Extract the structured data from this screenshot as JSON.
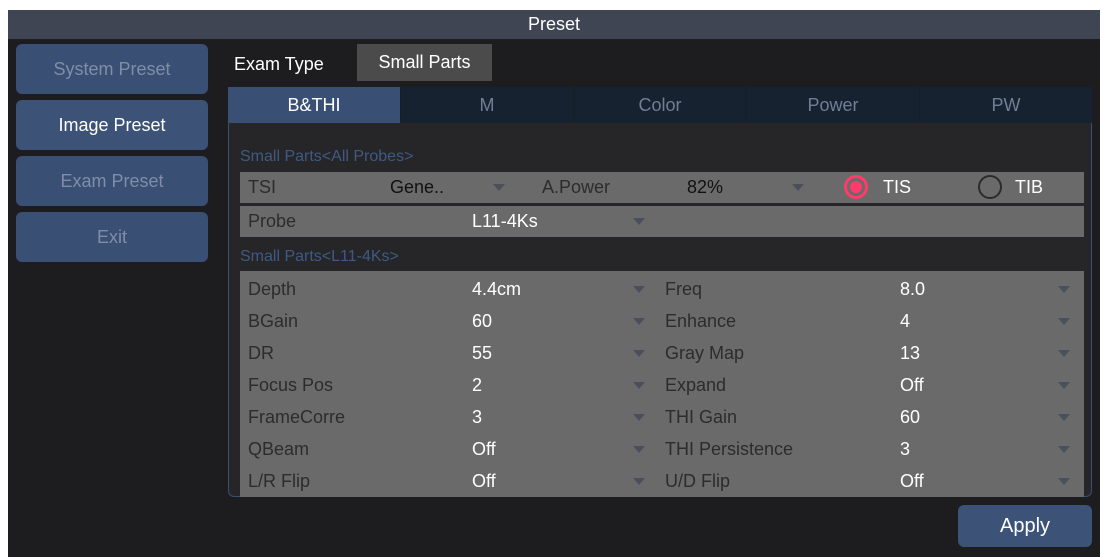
{
  "window": {
    "title": "Preset"
  },
  "sidebar": {
    "items": [
      {
        "label": "System Preset",
        "active": false
      },
      {
        "label": "Image Preset",
        "active": true
      },
      {
        "label": "Exam Preset",
        "active": false
      },
      {
        "label": "Exit",
        "active": false
      }
    ]
  },
  "exam": {
    "label": "Exam Type",
    "value": "Small Parts"
  },
  "tabs": [
    "B&THI",
    "M",
    "Color",
    "Power",
    "PW"
  ],
  "active_tab": "B&THI",
  "all_probes": {
    "section_title": "Small Parts<All Probes>",
    "tsi_label": "TSI",
    "tsi_value": "Gene..",
    "apower_label": "A.Power",
    "apower_value": "82%",
    "tis_label": "TIS",
    "tib_label": "TIB",
    "selected_index": "TIS",
    "probe_label": "Probe",
    "probe_value": "L11-4Ks"
  },
  "probe_params": {
    "section_title": "Small Parts<L11-4Ks>",
    "rows": [
      {
        "left_label": "Depth",
        "left_value": "4.4cm",
        "right_label": "Freq",
        "right_value": "8.0"
      },
      {
        "left_label": "BGain",
        "left_value": "60",
        "right_label": "Enhance",
        "right_value": "4"
      },
      {
        "left_label": "DR",
        "left_value": "55",
        "right_label": "Gray Map",
        "right_value": "13"
      },
      {
        "left_label": "Focus Pos",
        "left_value": "2",
        "right_label": "Expand",
        "right_value": "Off"
      },
      {
        "left_label": "FrameCorre",
        "left_value": "3",
        "right_label": "THI Gain",
        "right_value": "60"
      },
      {
        "left_label": "QBeam",
        "left_value": "Off",
        "right_label": "THI Persistence",
        "right_value": "3"
      },
      {
        "left_label": "L/R Flip",
        "left_value": "Off",
        "right_label": "U/D Flip",
        "right_value": "Off"
      }
    ]
  },
  "apply": {
    "label": "Apply"
  },
  "colors": {
    "accent_blue": "#3a4f74",
    "radio_selected": "#ff3b6b",
    "panel_grey": "#6a6a6a",
    "section_title": "#3f5a82"
  }
}
